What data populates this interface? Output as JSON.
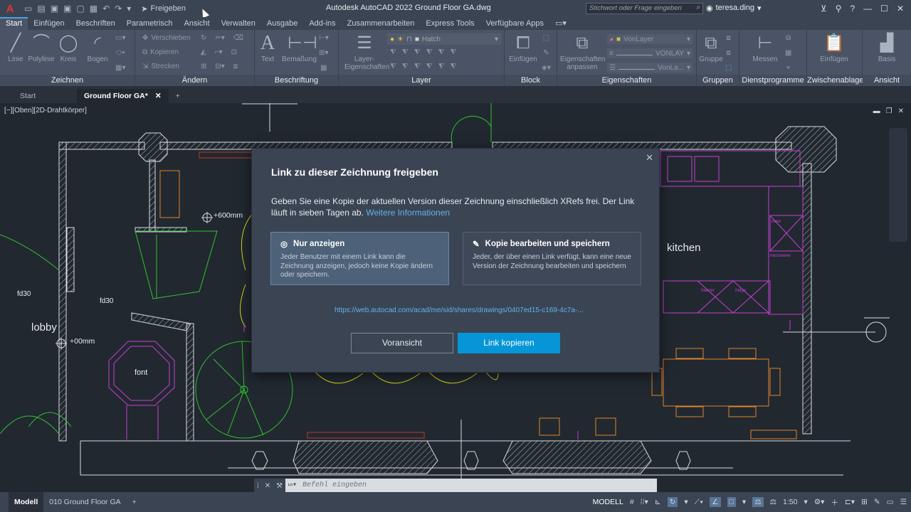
{
  "app": {
    "title": "Autodesk AutoCAD 2022   Ground Floor  GA.dwg",
    "share_label": "Freigeben",
    "search_placeholder": "Stichwort oder Frage eingeben",
    "user": "teresa.ding"
  },
  "ribbon": {
    "tabs": [
      "Start",
      "Einfügen",
      "Beschriften",
      "Parametrisch",
      "Ansicht",
      "Verwalten",
      "Ausgabe",
      "Add-ins",
      "Zusammenarbeiten",
      "Express Tools",
      "Verfügbare Apps"
    ],
    "active_tab": "Start",
    "panels": {
      "zeichnen": {
        "label": "Zeichnen",
        "items": [
          "Linie",
          "Polylinie",
          "Kreis",
          "Bogen"
        ]
      },
      "aendern": {
        "label": "Ändern",
        "items": [
          "Verschieben",
          "Kopieren",
          "Strecken"
        ]
      },
      "beschriftung": {
        "label": "Beschriftung",
        "items": [
          "Text",
          "Bemaßung"
        ]
      },
      "layer": {
        "label": "Layer",
        "items": [
          "Layer-Eigenschaften"
        ],
        "current_layer": "Hatch"
      },
      "block": {
        "label": "Block",
        "items": [
          "Einfügen"
        ]
      },
      "eigenschaften": {
        "label": "Eigenschaften",
        "items": [
          "Eigenschaften anpassen"
        ],
        "color": "VonLayer",
        "linetype": "VONLAY",
        "lineweight": "VonLa..."
      },
      "gruppen": {
        "label": "Gruppen",
        "items": [
          "Gruppe"
        ]
      },
      "dienstprogramme": {
        "label": "Dienstprogramme",
        "items": [
          "Messen"
        ]
      },
      "zwischenablage": {
        "label": "Zwischenablage",
        "items": [
          "Einfügen"
        ]
      },
      "ansicht": {
        "label": "Ansicht",
        "items": [
          "Basis"
        ]
      }
    }
  },
  "doc_tabs": {
    "start": "Start",
    "active": "Ground Floor  GA*"
  },
  "viewport": {
    "label": "[−][Oben][2D-Drahtkörper]",
    "texts": {
      "lobby": "lobby",
      "kitchen": "kitchen",
      "font": "font",
      "fd30_a": "fd30",
      "fd30_b": "fd30",
      "elev_a": "+600mm",
      "elev_b": "+00mm",
      "freezer": "freezer",
      "fridge": "fridge",
      "microwave": "microwave",
      "oven": "oven"
    }
  },
  "dialog": {
    "title": "Link zu dieser Zeichnung freigeben",
    "description": "Geben Sie eine Kopie der aktuellen Version dieser Zeichnung einschließlich XRefs frei. Der Link läuft in sieben Tagen ab.",
    "more_info": "Weitere Informationen",
    "option_view": {
      "title": "Nur anzeigen",
      "body": "Jeder Benutzer mit einem Link kann die Zeichnung anzeigen, jedoch keine Kopie ändern oder speichern."
    },
    "option_edit": {
      "title": "Kopie bearbeiten und speichern",
      "body": "Jeder, der über einen Link verfügt, kann eine neue Version der Zeichnung bearbeiten und speichern"
    },
    "link": "https://web.autocad.com/acad/me/sid/shares/drawings/0407ed15-c169-4c7a-...",
    "preview_button": "Voransicht",
    "copy_button": "Link kopieren"
  },
  "command_line": {
    "placeholder": "Befehl eingeben"
  },
  "status": {
    "model_tab": "Modell",
    "layout_tab": "010 Ground Floor GA",
    "mode": "MODELL",
    "scale": "1:50"
  }
}
